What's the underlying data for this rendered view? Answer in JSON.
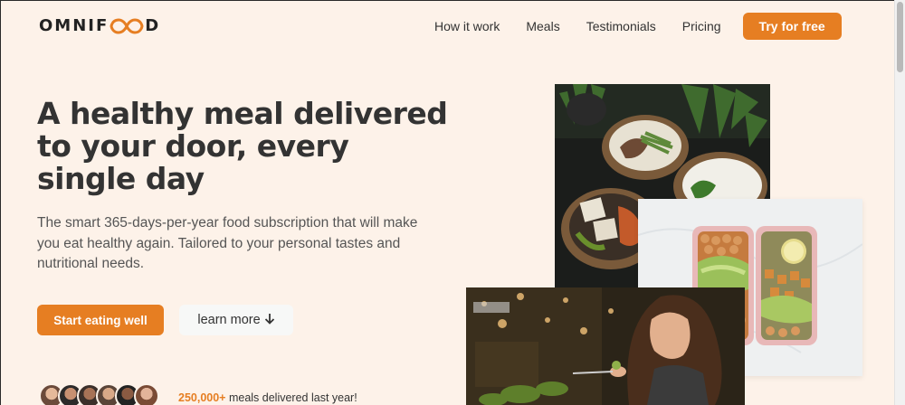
{
  "header": {
    "logo_text_start": "OMNIF",
    "logo_text_end": "D",
    "nav": [
      {
        "label": "How it work"
      },
      {
        "label": "Meals"
      },
      {
        "label": "Testimonials"
      },
      {
        "label": "Pricing"
      }
    ],
    "cta_label": "Try for free"
  },
  "hero": {
    "title": "A healthy meal delivered to your door, every single day",
    "description": "The smart 365-days-per-year food subscription that will make you eat healthy again. Tailored to your personal tastes and nutritional needs.",
    "primary_button": "Start eating well",
    "secondary_button": "learn more",
    "secondary_icon": "arrow-down-icon",
    "delivered_count": "250,000+",
    "delivered_text": " meals delivered last year!"
  },
  "colors": {
    "accent": "#e67e22",
    "background": "#fdf2e9",
    "text": "#333333"
  }
}
